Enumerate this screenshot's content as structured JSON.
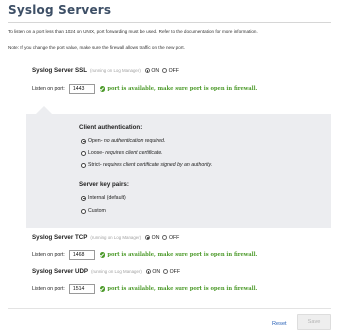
{
  "page": {
    "title": "Syslog Servers",
    "note1": "To listen on a port less than 1024 on UNIX, port forwarding must be used. Refer to the documentation for more information.",
    "note2": "Note: If you change the port value, make sure the firewall allows traffic on the new port."
  },
  "ssl": {
    "label": "Syslog Server SSL",
    "hint": "(running on Log Manager)",
    "on_label": "ON",
    "off_label": "OFF",
    "selected": "ON",
    "port_label": "Listen on port:",
    "port_value": "1443",
    "status_text": "port is available, make sure port is open in firewall."
  },
  "client_auth": {
    "heading": "Client authentication:",
    "options": [
      {
        "main": "Open",
        "sub": " - no authentication required.",
        "checked": true
      },
      {
        "main": "Loose",
        "sub": " - requires client certificate.",
        "checked": false
      },
      {
        "main": "Strict",
        "sub": " - requires client certificate signed by an authority.",
        "checked": false
      }
    ]
  },
  "server_key": {
    "heading": "Server key pairs:",
    "options": [
      {
        "label": "Internal (default)",
        "checked": true
      },
      {
        "label": "Custom",
        "checked": false
      }
    ]
  },
  "tcp": {
    "label": "Syslog Server TCP",
    "hint": "(running on Log Manager)",
    "on_label": "ON",
    "off_label": "OFF",
    "selected": "ON",
    "port_label": "Listen on port:",
    "port_value": "1468",
    "status_text": "port is available, make sure port is open in firewall."
  },
  "udp": {
    "label": "Syslog Server UDP",
    "hint": "(running on Log Manager)",
    "on_label": "ON",
    "off_label": "OFF",
    "selected": "ON",
    "port_label": "Listen on port:",
    "port_value": "1514",
    "status_text": "port is available, make sure port is open in firewall."
  },
  "footer": {
    "reset_label": "Reset",
    "save_label": "Save"
  },
  "colors": {
    "title": "#3d4f66",
    "ok_green": "#4c9a2a",
    "panel_bg": "#ecedf0",
    "link_blue": "#2b63b8"
  }
}
